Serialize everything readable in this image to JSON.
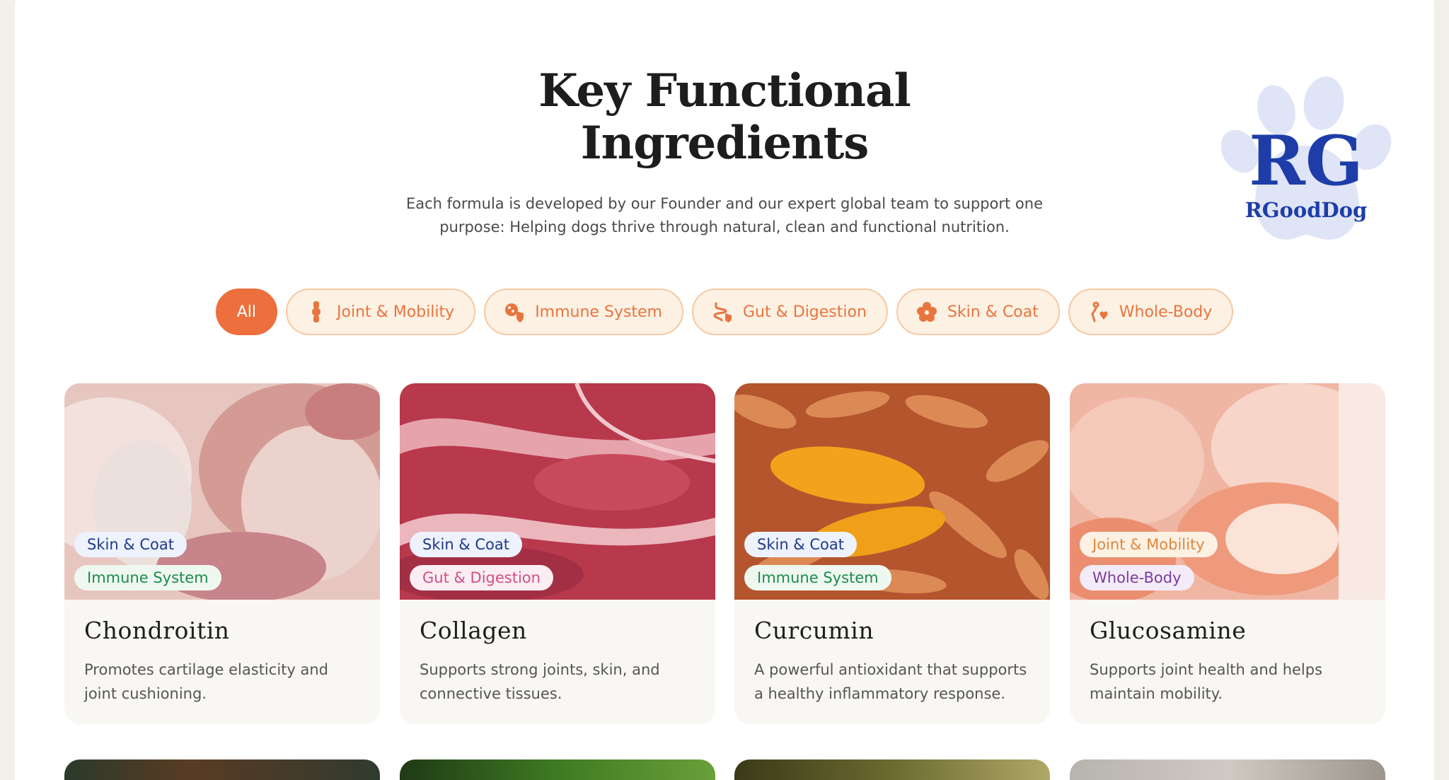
{
  "header": {
    "title_line1": "Key Functional",
    "title_line2": "Ingredients",
    "subtitle_line1": "Each formula is developed by our Founder and our expert global team to support one",
    "subtitle_line2": "purpose: Helping dogs thrive through natural, clean and functional nutrition.",
    "logo_monogram": "RG",
    "logo_text": "RGoodDog"
  },
  "filters": [
    {
      "label": "All",
      "icon": "none",
      "active": true
    },
    {
      "label": "Joint & Mobility",
      "icon": "bone-joint-icon"
    },
    {
      "label": "Immune System",
      "icon": "shield-cells-icon"
    },
    {
      "label": "Gut & Digestion",
      "icon": "intestine-icon"
    },
    {
      "label": "Skin & Coat",
      "icon": "flower-icon"
    },
    {
      "label": "Whole-Body",
      "icon": "body-heart-icon"
    }
  ],
  "cards": [
    {
      "name": "Chondroitin",
      "desc_line1": "Promotes cartilage elasticity and",
      "desc_line2": "joint cushioning.",
      "tags": [
        "Skin & Coat",
        "Immune System"
      ]
    },
    {
      "name": "Collagen",
      "desc_line1": "Supports strong joints, skin, and",
      "desc_line2": "connective tissues.",
      "tags": [
        "Skin & Coat",
        "Gut & Digestion"
      ]
    },
    {
      "name": "Curcumin",
      "desc_line1": "A powerful antioxidant that supports",
      "desc_line2": "a healthy inflammatory response.",
      "tags": [
        "Skin & Coat",
        "Immune System"
      ]
    },
    {
      "name": "Glucosamine",
      "desc_line1": "Supports joint health and helps",
      "desc_line2": "maintain mobility.",
      "tags": [
        "Joint & Mobility",
        "Whole-Body"
      ]
    }
  ],
  "colors": {
    "accent": "#ec6f3d",
    "chip_bg": "#fdf1e3",
    "logo_blue": "#1e3da8",
    "paw": "#dfe5f6"
  }
}
